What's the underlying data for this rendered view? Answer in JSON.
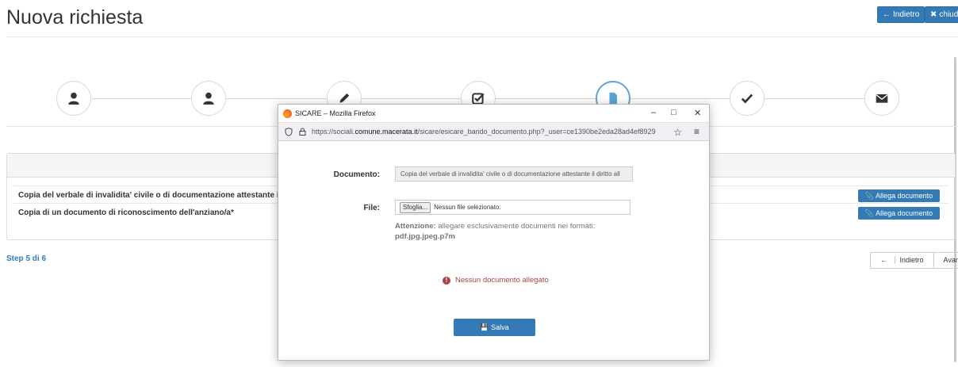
{
  "page": {
    "title": "Nuova richiesta",
    "back_button": "Indietro",
    "close_button": "chiud"
  },
  "wizard": {
    "steps": [
      {
        "icon": "user-icon"
      },
      {
        "icon": "user-icon"
      },
      {
        "icon": "pencil-icon"
      },
      {
        "icon": "check-square-icon"
      },
      {
        "icon": "document-icon",
        "active": true
      },
      {
        "icon": "checkmark-icon"
      },
      {
        "icon": "envelope-icon"
      }
    ]
  },
  "documents": {
    "rows": [
      {
        "label": "Copia del verbale di invalidita' civile o di documentazione attestante il diritt",
        "button": "Allega documento"
      },
      {
        "label": "Copia di un documento di riconoscimento dell'anziano/a*",
        "button": "Allega documento"
      }
    ]
  },
  "footer": {
    "step_label": "Step 5 di 6",
    "prev_label": "Indietro",
    "next_label": "Avanti"
  },
  "popup": {
    "window_title": "SICARE – Mozilla Firefox",
    "url_prefix": "https://sociali.",
    "url_domain": "comune.macerata.it",
    "url_rest": "/sicare/esicare_bando_documento.php?_user=ce1390be2eda28ad4ef8929",
    "document_label": "Documento:",
    "document_value": "Copia del verbale di invalidita' civile o di documentazione attestante il diritto all",
    "file_label": "File:",
    "browse_label": "Sfoglia...",
    "file_value": "Nessun file selezionato.",
    "warning_bold": "Attenzione:",
    "warning_text": "allegare esclusivamente documenti nei formati:",
    "formats": "pdf.jpg.jpeg.p7m",
    "error_message": "Nessun documento allegato",
    "save_label": "Salva"
  },
  "colors": {
    "primary": "#337ab7",
    "error": "#a94442",
    "step_link": "#337ab7"
  }
}
